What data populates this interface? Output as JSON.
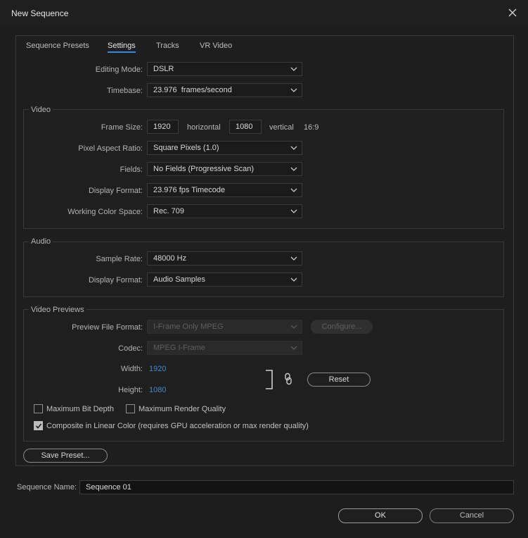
{
  "window": {
    "title": "New Sequence"
  },
  "tabs": [
    {
      "label": "Sequence Presets"
    },
    {
      "label": "Settings",
      "active": true
    },
    {
      "label": "Tracks"
    },
    {
      "label": "VR Video"
    }
  ],
  "general": {
    "editing_mode": {
      "label": "Editing Mode:",
      "value": "DSLR"
    },
    "timebase": {
      "label": "Timebase:",
      "value": "23.976  frames/second"
    }
  },
  "video": {
    "title": "Video",
    "frame_size": {
      "label": "Frame Size:",
      "width": "1920",
      "width_unit": "horizontal",
      "height": "1080",
      "height_unit": "vertical",
      "aspect": "16:9"
    },
    "pixel_aspect_ratio": {
      "label": "Pixel Aspect Ratio:",
      "value": "Square Pixels (1.0)"
    },
    "fields": {
      "label": "Fields:",
      "value": "No Fields (Progressive Scan)"
    },
    "display_format": {
      "label": "Display Format:",
      "value": "23.976 fps Timecode"
    },
    "working_color_space": {
      "label": "Working Color Space:",
      "value": "Rec. 709"
    }
  },
  "audio": {
    "title": "Audio",
    "sample_rate": {
      "label": "Sample Rate:",
      "value": "48000 Hz"
    },
    "display_format": {
      "label": "Display Format:",
      "value": "Audio Samples"
    }
  },
  "previews": {
    "title": "Video Previews",
    "preview_file_format": {
      "label": "Preview File Format:",
      "value": "I-Frame Only MPEG"
    },
    "configure_label": "Configure...",
    "codec": {
      "label": "Codec:",
      "value": "MPEG I-Frame"
    },
    "width": {
      "label": "Width:",
      "value": "1920"
    },
    "height": {
      "label": "Height:",
      "value": "1080"
    },
    "reset_label": "Reset",
    "max_bit_depth": {
      "label": "Maximum Bit Depth",
      "checked": false
    },
    "max_render_quality": {
      "label": "Maximum Render Quality",
      "checked": false
    },
    "composite_linear": {
      "label": "Composite in Linear Color (requires GPU acceleration or max render quality)",
      "checked": true
    }
  },
  "save_preset_label": "Save Preset...",
  "sequence_name": {
    "label": "Sequence Name:",
    "value": "Sequence 01"
  },
  "footer": {
    "ok_label": "OK",
    "cancel_label": "Cancel"
  },
  "colors": {
    "accent": "#2d8ceb",
    "link_value": "#2f8fe8",
    "background": "#1e1e1e"
  }
}
